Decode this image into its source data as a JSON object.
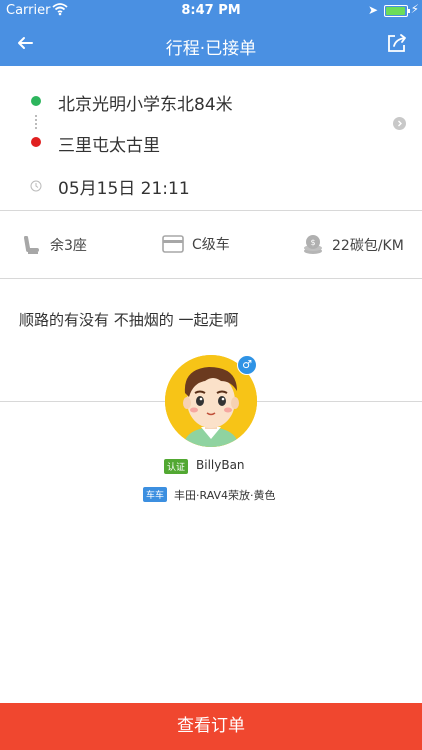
{
  "status_bar": {
    "carrier": "Carrier",
    "time": "8:47 PM",
    "battery_level": 0.95
  },
  "nav": {
    "title": "行程·已接单"
  },
  "route": {
    "start": "北京光明小学东北84米",
    "end": "三里屯太古里",
    "datetime": "05月15日 21:11",
    "start_color": "#2db55d",
    "end_color": "#e02020"
  },
  "info": {
    "seats": "余3座",
    "car_class": "C级车",
    "price": "22碳包/KM"
  },
  "note": "顺路的有没有 不抽烟的 一起走啊",
  "driver": {
    "gender_symbol": "♂",
    "verified_badge": "认证",
    "name": "BillyBan",
    "car_badge": "车车",
    "car": "丰田·RAV4荣放·黄色"
  },
  "bottom_button": "查看订单",
  "colors": {
    "primary": "#4a90e2",
    "action": "#f0472f",
    "verified": "#52a832",
    "car_badge": "#3c8fe0"
  }
}
